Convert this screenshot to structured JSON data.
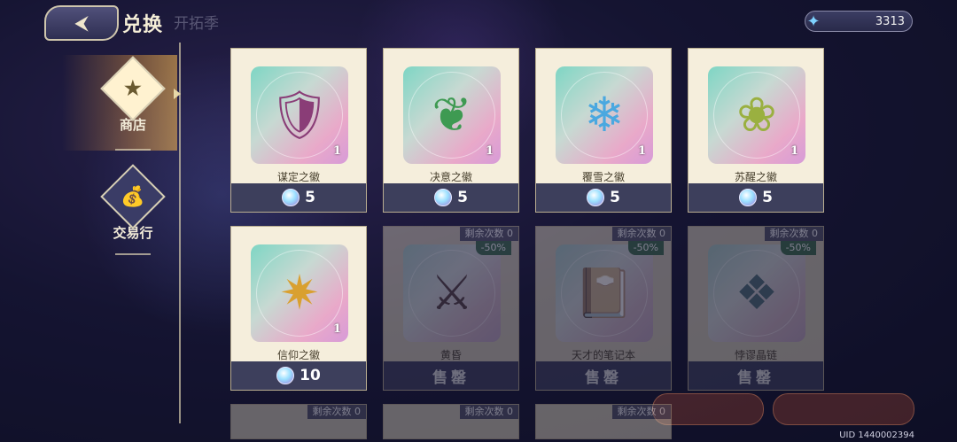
{
  "header": {
    "back_icon": "back-arrow-icon",
    "title": "兑换",
    "ghost_title": "开拓季"
  },
  "currency": {
    "icon": "crystal-currency-icon",
    "amount": "3313"
  },
  "sidebar": {
    "items": [
      {
        "label": "商店",
        "icon": "star-banner-icon",
        "active": true
      },
      {
        "label": "交易行",
        "icon": "money-bag-icon",
        "active": false
      }
    ]
  },
  "shop": {
    "cards": [
      {
        "name": "谋定之徽",
        "qty": "1",
        "price": "5",
        "glyph": "🛡",
        "glyph_color": "#8a3d77"
      },
      {
        "name": "决意之徽",
        "qty": "1",
        "price": "5",
        "glyph": "❦",
        "glyph_color": "#3e9a52"
      },
      {
        "name": "覆雪之徽",
        "qty": "1",
        "price": "5",
        "glyph": "❄",
        "glyph_color": "#4aa8e0"
      },
      {
        "name": "苏醒之徽",
        "qty": "1",
        "price": "5",
        "glyph": "❀",
        "glyph_color": "#9ab040"
      },
      {
        "name": "信仰之徽",
        "qty": "1",
        "price": "10",
        "glyph": "✷",
        "glyph_color": "#d9a030"
      },
      {
        "name": "黄昏",
        "remain": "剩余次数 0",
        "discount": "-50%",
        "sold": "售罄",
        "glyph": "⚔",
        "glyph_color": "#6a3a3a"
      },
      {
        "name": "天才的笔记本",
        "remain": "剩余次数 0",
        "discount": "-50%",
        "sold": "售罄",
        "glyph": "📔",
        "glyph_color": "#5a3a2a"
      },
      {
        "name": "悖谬晶链",
        "remain": "剩余次数 0",
        "discount": "-50%",
        "sold": "售罄",
        "glyph": "❖",
        "glyph_color": "#2a7a8a"
      }
    ],
    "partial_cards": [
      {
        "remain": "剩余次数 0"
      },
      {
        "remain": "剩余次数 0"
      },
      {
        "remain": "剩余次数 0"
      }
    ]
  },
  "footer": {
    "uid": "UID 1440002394"
  }
}
